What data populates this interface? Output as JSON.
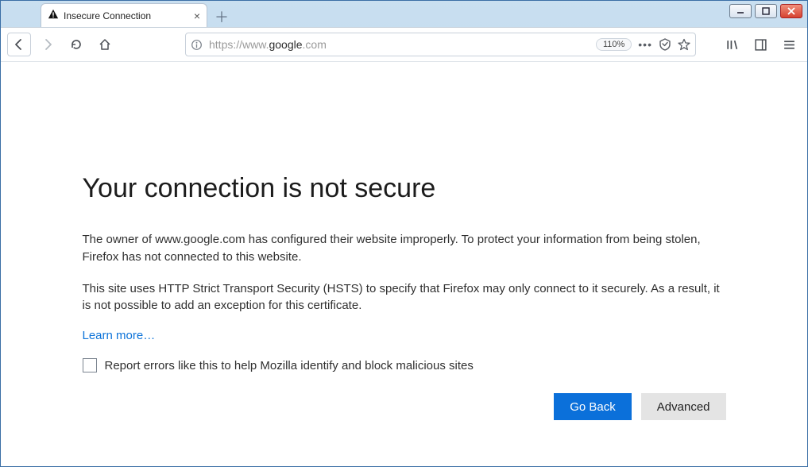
{
  "window": {
    "tab_title": "Insecure Connection"
  },
  "toolbar": {
    "url_prefix": "https://www.",
    "url_host": "google",
    "url_suffix": ".com",
    "zoom": "110%"
  },
  "page": {
    "heading": "Your connection is not secure",
    "para1": "The owner of www.google.com has configured their website improperly. To protect your information from being stolen, Firefox has not connected to this website.",
    "para2": "This site uses HTTP Strict Transport Security (HSTS) to specify that Firefox may only connect to it securely. As a result, it is not possible to add an exception for this certificate.",
    "learn_more": "Learn more…",
    "report_label": "Report errors like this to help Mozilla identify and block malicious sites",
    "go_back": "Go Back",
    "advanced": "Advanced"
  }
}
